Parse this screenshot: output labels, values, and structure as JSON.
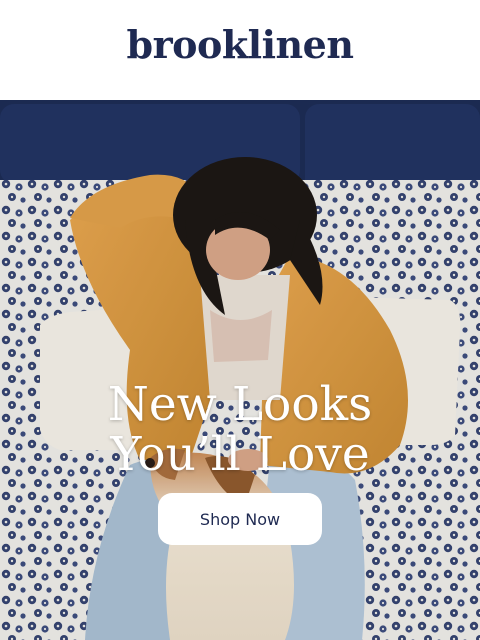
{
  "header": {
    "logo_text": "brooklinen"
  },
  "hero": {
    "headline_line1": "New Looks",
    "headline_line2": "You’ll Love",
    "cta_label": "Shop Now"
  }
}
